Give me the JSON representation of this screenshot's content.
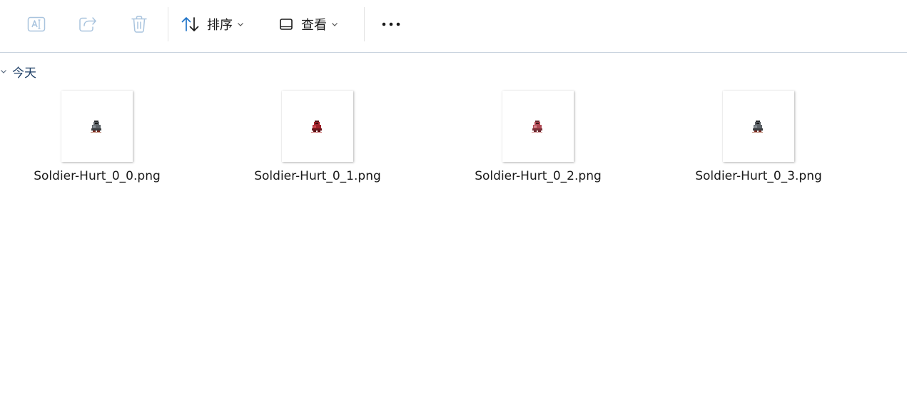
{
  "toolbar": {
    "buttons": [
      {
        "name": "rename",
        "icon": "rename-icon",
        "enabled": false
      },
      {
        "name": "share",
        "icon": "share-icon",
        "enabled": false
      },
      {
        "name": "delete",
        "icon": "trash-icon",
        "enabled": false
      }
    ],
    "sort_label": "排序",
    "sort_icon": "sort-arrows-icon",
    "view_label": "查看",
    "view_icon": "view-square-icon",
    "more_icon": "more-dots-icon"
  },
  "colors": {
    "accent": "#1e73c8",
    "disabled_icon": "#a9c4de",
    "group_label": "#1e3f66",
    "divider": "#c9d3de"
  },
  "group": {
    "label": "今天",
    "expanded": true
  },
  "files": [
    {
      "name": "Soldier-Hurt_0_0.png",
      "tint": "#5e6469"
    },
    {
      "name": "Soldier-Hurt_0_1.png",
      "tint": "#a0222a"
    },
    {
      "name": "Soldier-Hurt_0_2.png",
      "tint": "#b04a55"
    },
    {
      "name": "Soldier-Hurt_0_3.png",
      "tint": "#5e6469"
    }
  ]
}
